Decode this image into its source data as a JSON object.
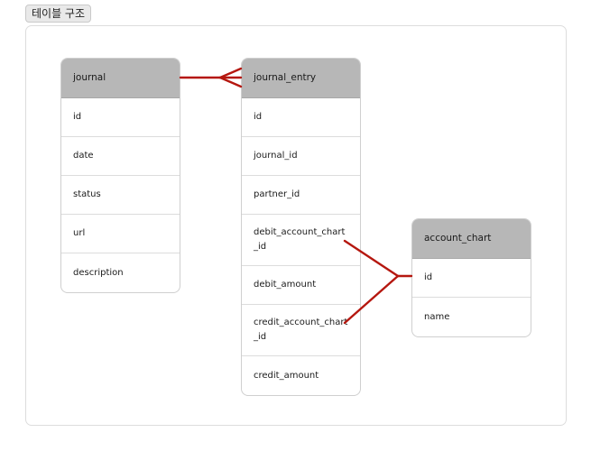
{
  "page": {
    "tag": "테이블 구조"
  },
  "tables": {
    "journal": {
      "name": "journal",
      "fields": [
        "id",
        "date",
        "status",
        "url",
        "description"
      ]
    },
    "journal_entry": {
      "name": "journal_entry",
      "fields": [
        "id",
        "journal_id",
        "partner_id",
        "debit_account_chart_id",
        "debit_amount",
        "credit_account_chart_id",
        "credit_amount"
      ]
    },
    "account_chart": {
      "name": "account_chart",
      "fields": [
        "id",
        "name"
      ]
    }
  },
  "relations": [
    {
      "from": "journal.id",
      "to": "journal_entry.journal_id",
      "type": "one-to-many"
    },
    {
      "from": "journal_entry.debit_account_chart_id",
      "to": "account_chart.id",
      "type": "many-to-one"
    },
    {
      "from": "journal_entry.credit_account_chart_id",
      "to": "account_chart.id",
      "type": "many-to-one"
    }
  ],
  "colors": {
    "relation_line": "#b5170f",
    "table_header": "#b7b7b7",
    "table_border": "#cfcfcf"
  }
}
